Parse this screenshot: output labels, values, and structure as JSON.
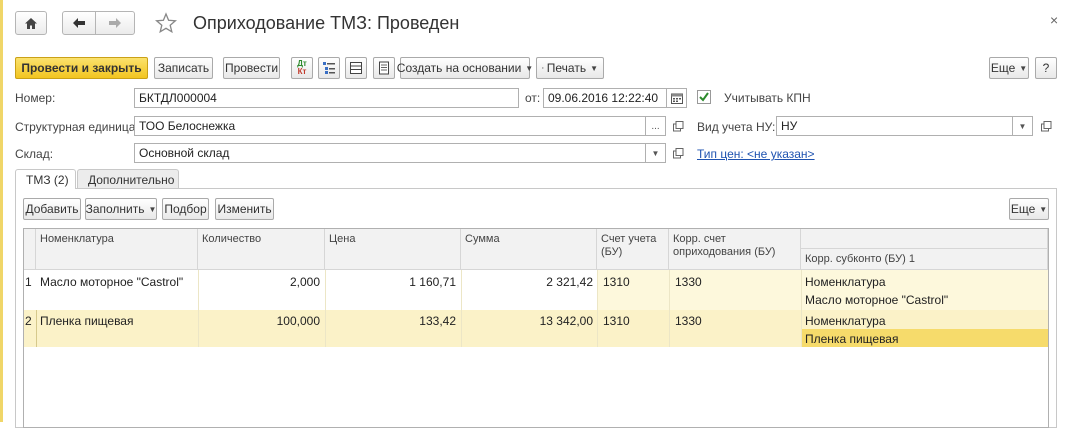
{
  "window": {
    "title": "Оприходование ТМЗ: Проведен",
    "close_glyph": "×"
  },
  "toolbar": {
    "post_and_close": "Провести и закрыть",
    "save": "Записать",
    "post": "Провести",
    "dt_icon_top": "Дт",
    "dt_icon_bottom": "Кт",
    "create_based_on": "Создать на основании",
    "print": "Печать",
    "more": "Еще",
    "help": "?"
  },
  "form": {
    "number_label": "Номер:",
    "number_value": "БКТДЛ000004",
    "date_label": "от:",
    "date_value": "09.06.2016 12:22:40",
    "kpn_label": "Учитывать КПН",
    "kpn_checked": true,
    "unit_label": "Структурная единица:",
    "unit_value": "ТОО Белоснежка",
    "nu_label": "Вид учета НУ:",
    "nu_value": "НУ",
    "warehouse_label": "Склад:",
    "warehouse_value": "Основной склад",
    "price_type_link": "Тип цен: <не указан>"
  },
  "tabs": [
    {
      "label": "ТМЗ (2)",
      "active": true
    },
    {
      "label": "Дополнительно",
      "active": false
    }
  ],
  "table_toolbar": {
    "add": "Добавить",
    "fill": "Заполнить",
    "pick": "Подбор",
    "change": "Изменить",
    "more": "Еще"
  },
  "table": {
    "columns": [
      "Номенклатура",
      "Количество",
      "Цена",
      "Сумма",
      "Счет учета (БУ)",
      "Корр. счет оприходования (БУ)",
      "Корр. субконто (БУ) 1"
    ],
    "rows": [
      {
        "n": "1",
        "item": "Масло моторное \"Castrol\"",
        "qty": "2,000",
        "price": "1 160,71",
        "sum": "2 321,42",
        "account": "1310",
        "corr_account": "1330",
        "subconto_type": "Номенклатура",
        "subconto_value": "Масло моторное \"Castrol\""
      },
      {
        "n": "2",
        "item": "Пленка пищевая",
        "qty": "100,000",
        "price": "133,42",
        "sum": "13 342,00",
        "account": "1310",
        "corr_account": "1330",
        "subconto_type": "Номенклатура",
        "subconto_value": "Пленка пищевая"
      }
    ]
  },
  "colors": {
    "primary_button": "#f2c520",
    "selected_row": "#fbf2c8",
    "row_highlight": "#fdf8dc",
    "active_cell": "#f6db6b",
    "link": "#1f53b0"
  }
}
